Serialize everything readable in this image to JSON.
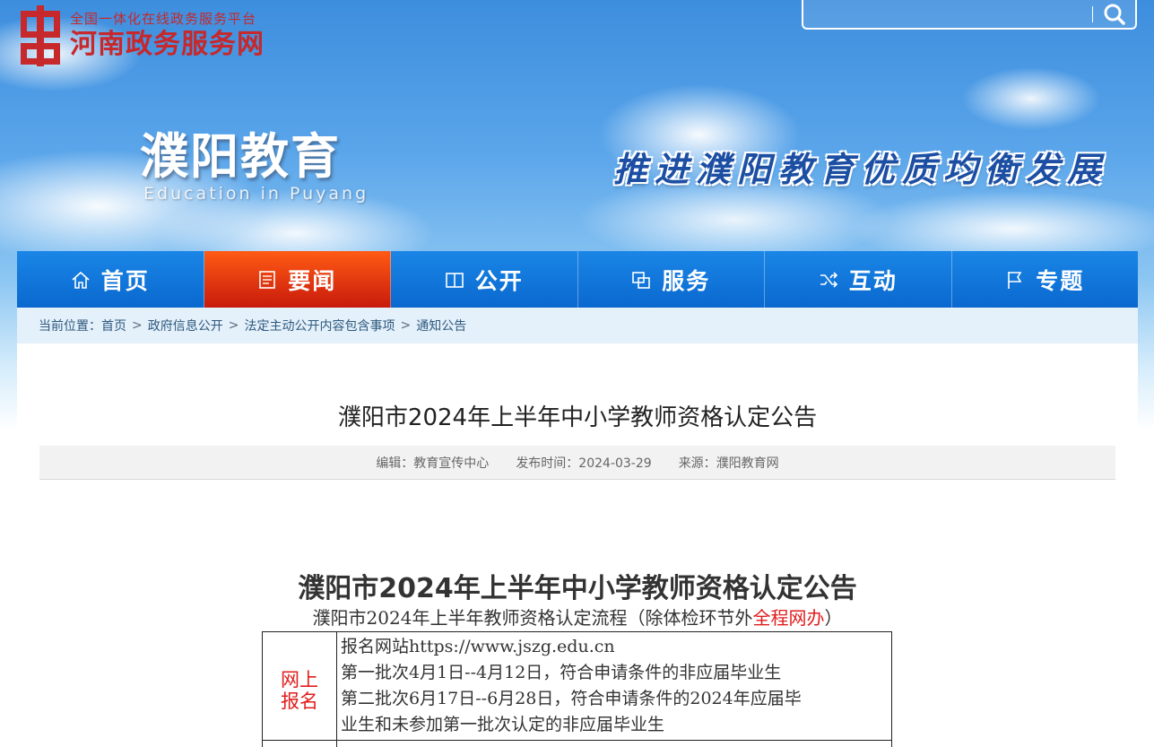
{
  "header": {
    "gov_portal_small": "全国一体化在线政务服务平台",
    "gov_portal_name": "河南政务服务网",
    "search_placeholder": "",
    "site_title": "濮阳教育",
    "site_subtitle": "Education in Puyang",
    "slogan": "推进濮阳教育优质均衡发展"
  },
  "nav": {
    "items": [
      {
        "label": "首页",
        "icon": "home-icon"
      },
      {
        "label": "要闻",
        "icon": "news-icon",
        "active": true
      },
      {
        "label": "公开",
        "icon": "book-icon"
      },
      {
        "label": "服务",
        "icon": "service-icon"
      },
      {
        "label": "互动",
        "icon": "shuffle-icon"
      },
      {
        "label": "专题",
        "icon": "flag-icon"
      }
    ],
    "active_color": "#e0300f",
    "bar_color": "#0f74d8"
  },
  "breadcrumb": {
    "prefix": "当前位置：",
    "items": [
      "首页",
      "政府信息公开",
      "法定主动公开内容包含事项",
      "通知公告"
    ],
    "separator": ">"
  },
  "article": {
    "title": "濮阳市2024年上半年中小学教师资格认定公告",
    "editor": "编辑：教育宣传中心",
    "publish_time": "发布时间：2024-03-29",
    "source": "来源：濮阳教育网",
    "doc_heading": "濮阳市2024年上半年中小学教师资格认定公告",
    "doc_sub_prefix": "濮阳市2024年上半年教师资格认定流程（除体检环节外",
    "doc_sub_highlight": "全程网办",
    "doc_sub_suffix": "）",
    "table": {
      "row1_label_line1": "网上",
      "row1_label_line2": "报名",
      "row1_lines": [
        "报名网站https://www.jszg.edu.cn",
        "第一批次4月1日--4月12日，符合申请条件的非应届毕业生",
        "第二批次6月17日--6月28日，符合申请条件的2024年应届毕",
        "业生和未参加第一批次认定的非应届毕业生"
      ]
    }
  }
}
